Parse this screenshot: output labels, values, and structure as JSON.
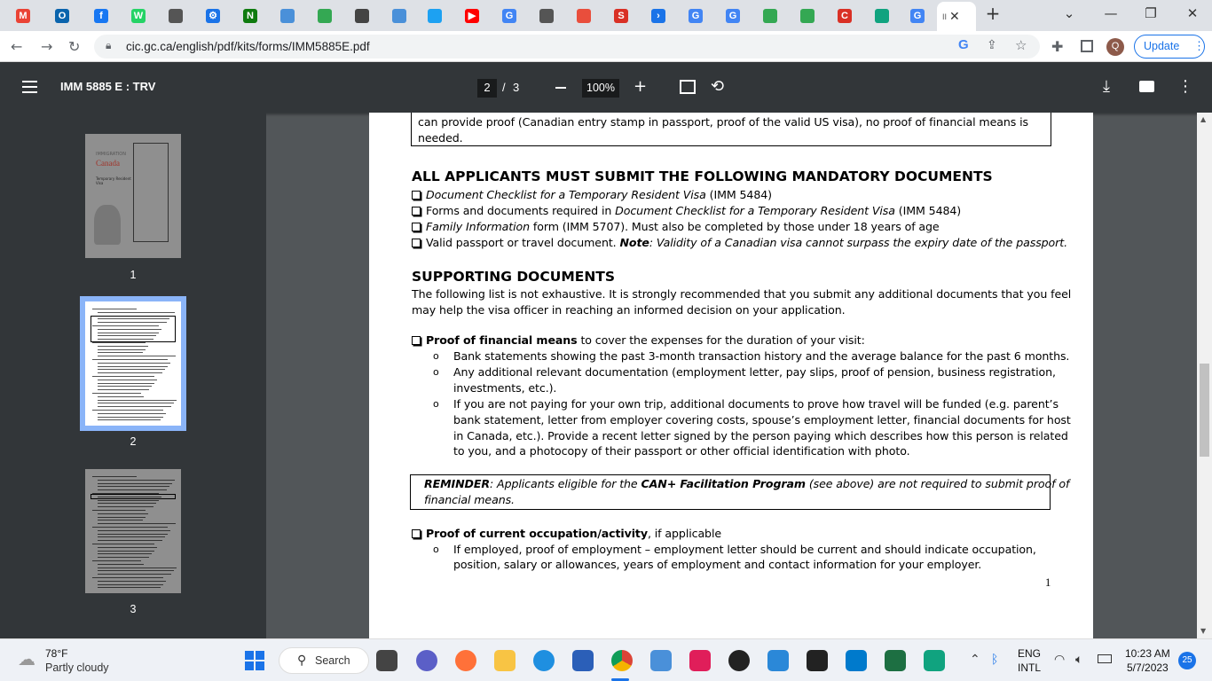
{
  "browser": {
    "tabs": [
      {
        "icon": "gmail-icon",
        "color": "#ea4335",
        "text": "M"
      },
      {
        "icon": "outlook-icon",
        "color": "#0a64ad",
        "text": "O"
      },
      {
        "icon": "facebook-icon",
        "color": "#1877f2",
        "text": "f"
      },
      {
        "icon": "whatsapp-icon",
        "color": "#25d366",
        "text": "W"
      },
      {
        "icon": "github-icon",
        "color": "#555555",
        "text": ""
      },
      {
        "icon": "settings-icon",
        "color": "#1a73e8",
        "text": "⚙"
      },
      {
        "icon": "sheet-icon",
        "color": "#0f7b0f",
        "text": "N"
      },
      {
        "icon": "bird-icon",
        "color": "#4a90d9",
        "text": ""
      },
      {
        "icon": "tab-icon",
        "color": "#34a853",
        "text": ""
      },
      {
        "icon": "arrow-icon",
        "color": "#444444",
        "text": ""
      },
      {
        "icon": "bird-icon",
        "color": "#4a90d9",
        "text": ""
      },
      {
        "icon": "twitter-icon",
        "color": "#1da1f2",
        "text": ""
      },
      {
        "icon": "youtube-icon",
        "color": "#ff0000",
        "text": "▶"
      },
      {
        "icon": "google-icon",
        "color": "#4285f4",
        "text": "G"
      },
      {
        "icon": "github-icon",
        "color": "#555555",
        "text": ""
      },
      {
        "icon": "flame-icon",
        "color": "#e94e3c",
        "text": ""
      },
      {
        "icon": "s-icon",
        "color": "#d93025",
        "text": "S"
      },
      {
        "icon": "chevron-icon",
        "color": "#1a73e8",
        "text": "›"
      },
      {
        "icon": "google-icon",
        "color": "#4285f4",
        "text": "G"
      },
      {
        "icon": "google-icon",
        "color": "#4285f4",
        "text": "G"
      },
      {
        "icon": "pen-icon",
        "color": "#34a853",
        "text": ""
      },
      {
        "icon": "pen-icon",
        "color": "#34a853",
        "text": ""
      },
      {
        "icon": "c-icon",
        "color": "#d93025",
        "text": "C"
      },
      {
        "icon": "openai-icon",
        "color": "#10a37f",
        "text": ""
      },
      {
        "icon": "google-icon",
        "color": "#4285f4",
        "text": "G"
      }
    ],
    "active_tab_text": "II",
    "url": "cic.gc.ca/english/pdf/kits/forms/IMM5885E.pdf",
    "profile_initial": "Q",
    "update_label": "Update"
  },
  "pdf": {
    "title": "IMM 5885 E : TRV",
    "current_page": "2",
    "separator": "/",
    "total_pages": "3",
    "zoom": "100%",
    "thumbnails": [
      "1",
      "2",
      "3"
    ]
  },
  "doc": {
    "box_line1": "can provide proof (Canadian entry stamp in passport, proof of the valid US visa), no proof of financial means is",
    "box_line2": "needed.",
    "mandatory_heading": "ALL APPLICANTS MUST SUBMIT THE FOLLOWING MANDATORY DOCUMENTS",
    "m1_italic": "Document Checklist for a Temporary Resident Visa",
    "m1_rest": " (IMM 5484)",
    "m2_pre": "Forms and documents required in ",
    "m2_italic": "Document Checklist for a Temporary Resident Visa",
    "m2_rest": " (IMM 5484)",
    "m3_italic": "Family Information",
    "m3_rest": " form (IMM 5707). Must also be completed by those under 18 years of age",
    "m4_pre": "Valid passport or travel document. ",
    "m4_note": "Note",
    "m4_italic": ": Validity of a Canadian visa cannot surpass the expiry date of the passport.",
    "supporting_heading": "SUPPORTING DOCUMENTS",
    "supporting_p1": "The following list is not exhaustive. It is strongly recommended that you submit any additional documents that you feel",
    "supporting_p2": "may help the visa officer in reaching an informed decision on your application.",
    "fin_bold": "Proof of financial means",
    "fin_rest": " to cover the expenses for the duration of your visit:",
    "fin_b1": "Bank statements showing the past 3-month transaction history and the average balance for the past 6 months.",
    "fin_b2_l1": "Any additional relevant documentation (employment letter, pay slips, proof of pension, business registration,",
    "fin_b2_l2": "investments, etc.).",
    "fin_b3_l1": "If you are not paying for your own trip, additional documents to prove how travel will be funded (e.g. parent’s",
    "fin_b3_l2": "bank statement, letter from employer covering costs, spouse’s employment letter, financial documents for host",
    "fin_b3_l3": "in Canada, etc.). Provide a recent letter signed by the person paying which describes how this person is related",
    "fin_b3_l4": "to you, and a photocopy of their passport or other official identification with photo.",
    "rem_label": "REMINDER",
    "rem_mid": ": Applicants eligible for the ",
    "rem_bold": "CAN+ Facilitation Program",
    "rem_end": " (see above) are not required to submit proof of",
    "rem_l2": "financial means.",
    "occ_bold": "Proof of current occupation/activity",
    "occ_rest": ", if applicable",
    "occ_b1_l1": "If employed, proof of employment – employment letter should be current and should indicate occupation,",
    "occ_b1_l2": "position, salary or allowances, years of employment and contact information for your employer.",
    "page_number": "1",
    "bullet_glyph": "o"
  },
  "thumb1": {
    "title_a": "IMMIGRATION",
    "title_b": "Canada",
    "sub": "Temporary Resident Visa"
  },
  "taskbar": {
    "weather_temp": "78°F",
    "weather_desc": "Partly cloudy",
    "search_label": "Search",
    "lang1": "ENG",
    "lang2": "INTL",
    "time": "10:23 AM",
    "date": "5/7/2023",
    "notif_count": "25",
    "apps": [
      {
        "name": "task-view-icon",
        "color": "#444444"
      },
      {
        "name": "teams-icon",
        "color": "#5b5fc7"
      },
      {
        "name": "firefox-icon",
        "color": "#ff7139"
      },
      {
        "name": "file-explorer-icon",
        "color": "#f8c444"
      },
      {
        "name": "edge-icon",
        "color": "#1f8fe0"
      },
      {
        "name": "store-icon",
        "color": "#2b5fb8"
      },
      {
        "name": "chrome-icon",
        "color": "#db4437"
      },
      {
        "name": "bird-app-icon",
        "color": "#4a90d9"
      },
      {
        "name": "slack-icon",
        "color": "#e01e5a"
      },
      {
        "name": "media-player-icon",
        "color": "#222222"
      },
      {
        "name": "notepad-icon",
        "color": "#2b88d8"
      },
      {
        "name": "terminal-icon",
        "color": "#222222"
      },
      {
        "name": "vscode-icon",
        "color": "#007acc"
      },
      {
        "name": "excel-icon",
        "color": "#1d6f42"
      },
      {
        "name": "leaf-app-icon",
        "color": "#10a37f"
      }
    ]
  }
}
